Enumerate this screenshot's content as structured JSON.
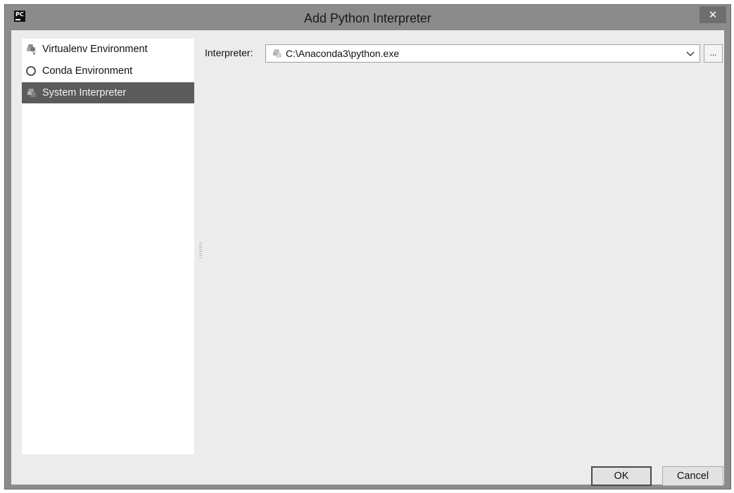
{
  "window": {
    "title": "Add Python Interpreter",
    "app_icon_text": "PC",
    "close_glyph": "✕"
  },
  "sidebar": {
    "items": [
      {
        "label": "Virtualenv Environment",
        "icon": "virtualenv-icon",
        "selected": false
      },
      {
        "label": "Conda Environment",
        "icon": "conda-ring-icon",
        "selected": false
      },
      {
        "label": "System Interpreter",
        "icon": "python-icon",
        "selected": true
      }
    ]
  },
  "interpreter": {
    "label": "Interpreter:",
    "value": "C:\\Anaconda3\\python.exe",
    "browse_label": "..."
  },
  "buttons": {
    "ok": "OK",
    "cancel": "Cancel"
  },
  "colors": {
    "title_bar": "#8b8b8b",
    "dialog_bg": "#ececec",
    "selection": "#5b5b5b"
  }
}
